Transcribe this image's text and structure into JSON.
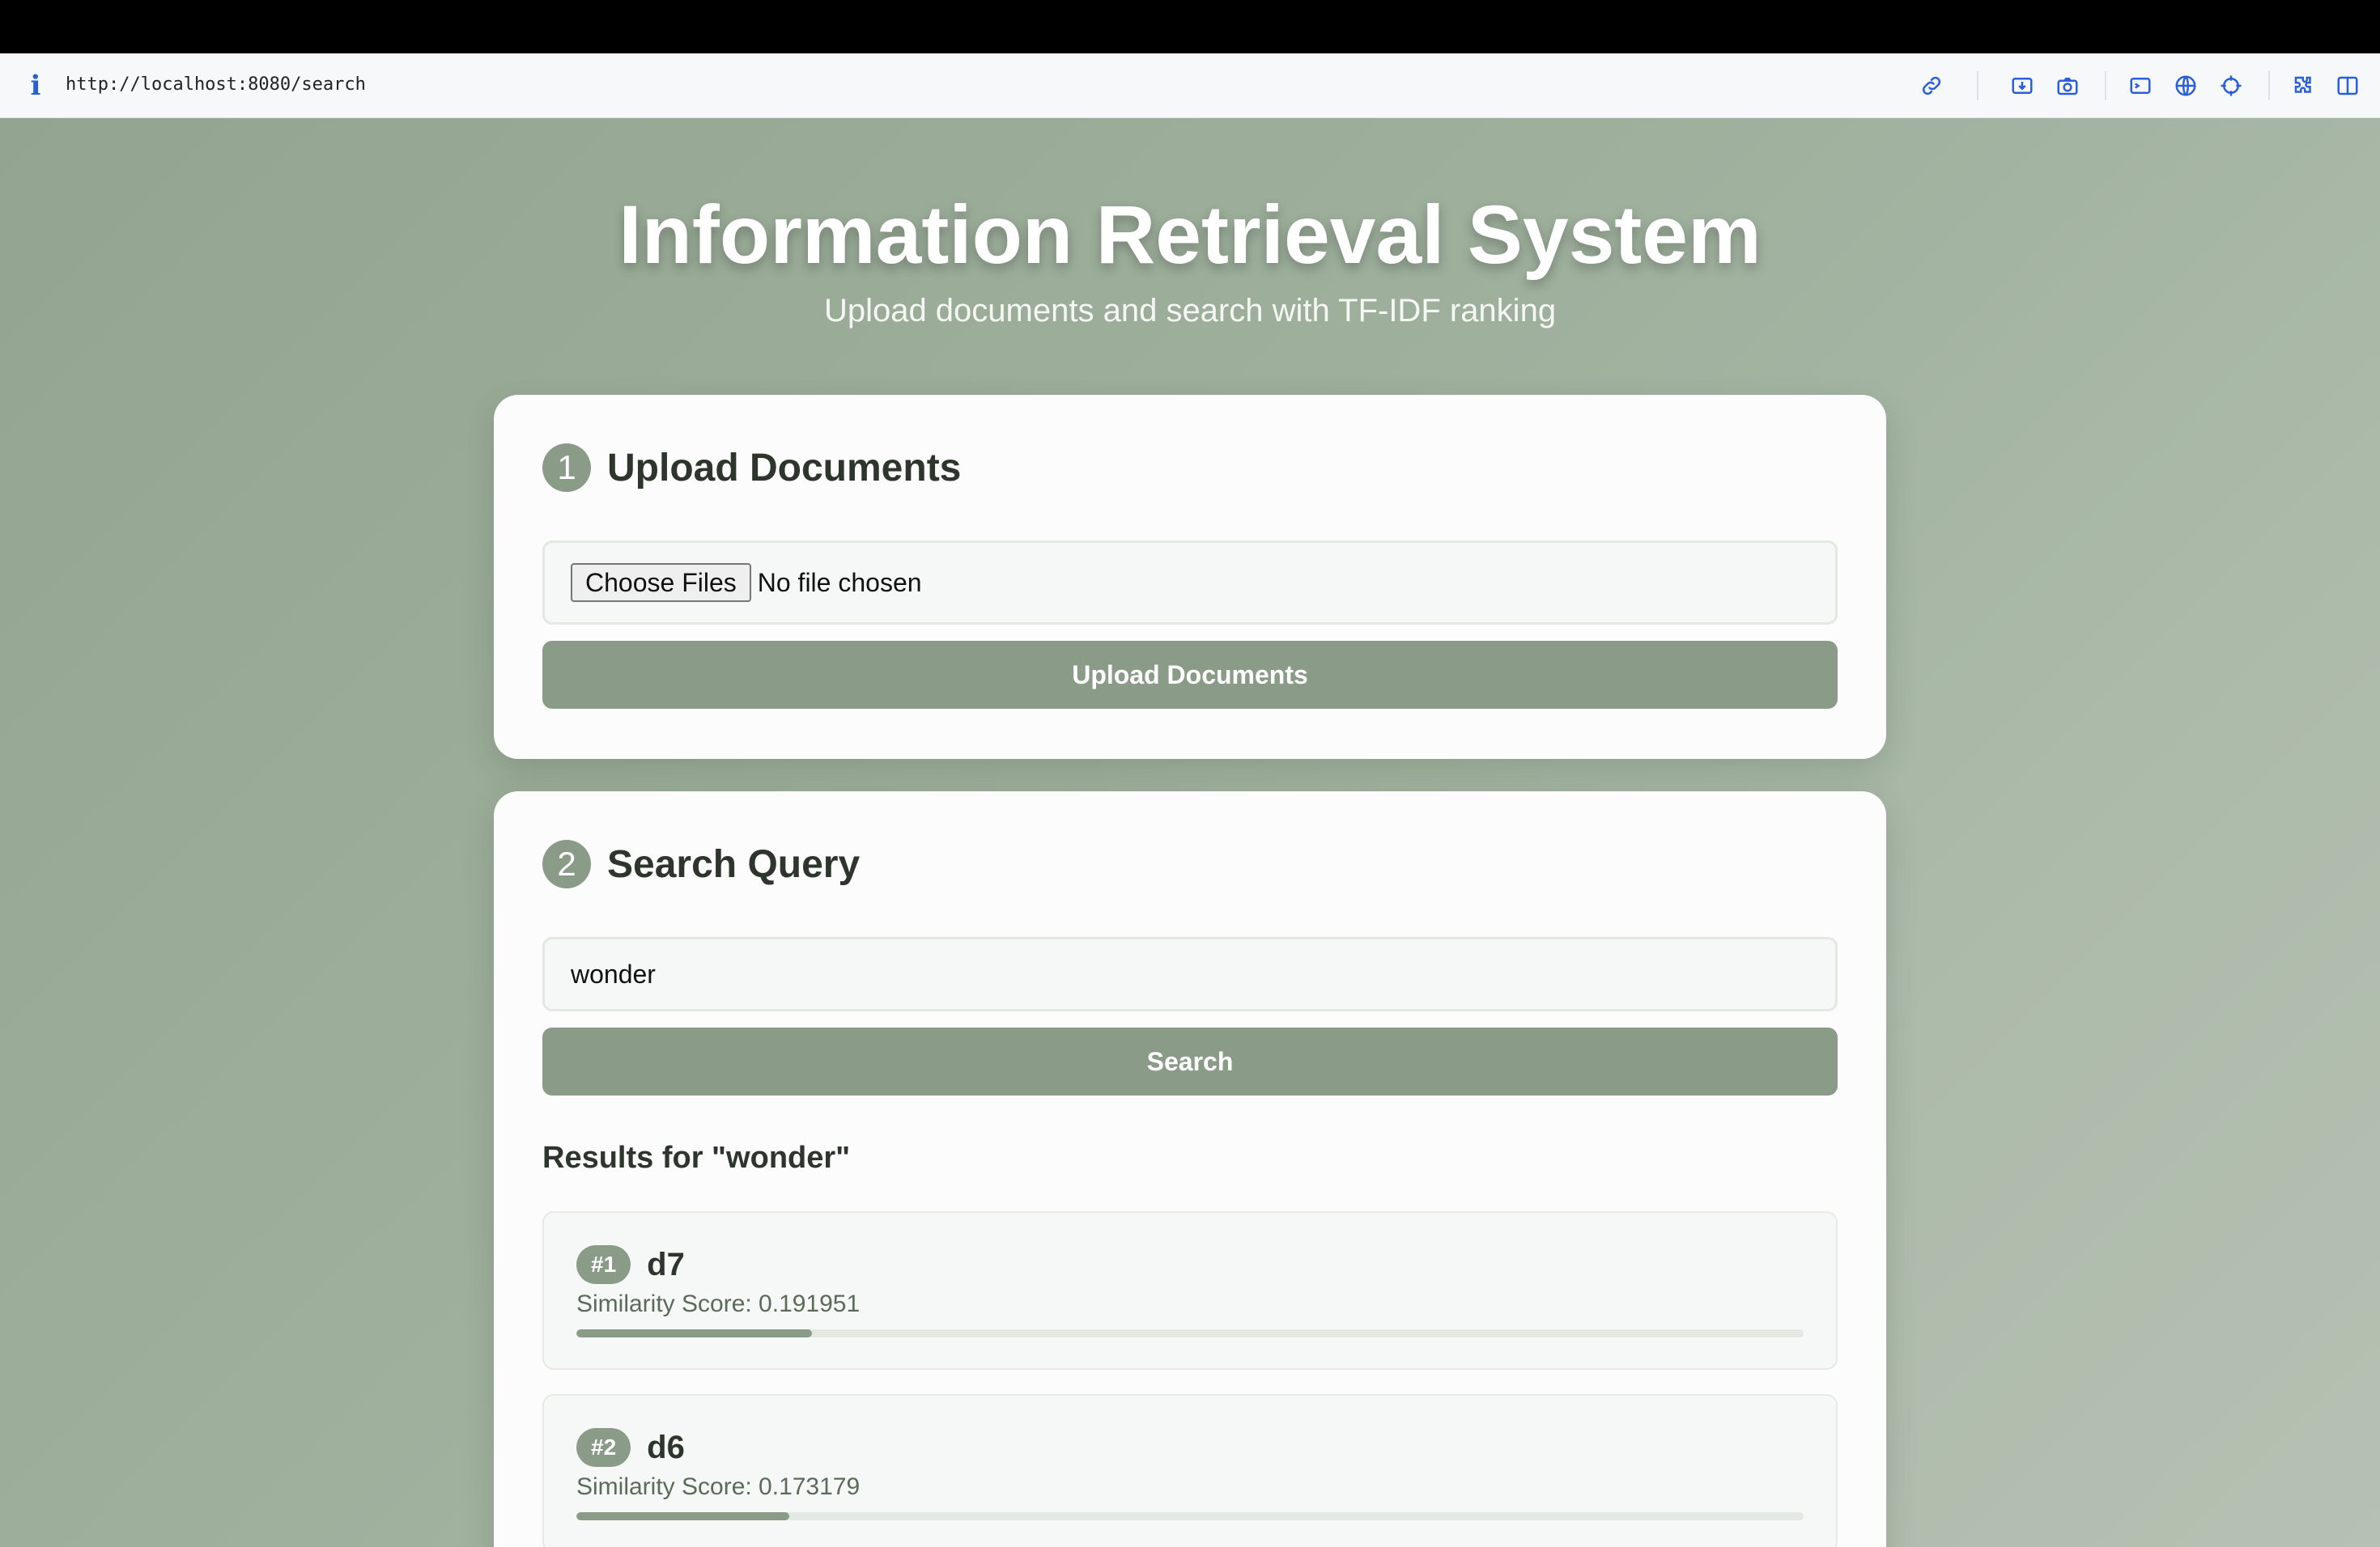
{
  "browser": {
    "url": "http://localhost:8080/search",
    "toolbar_icons": [
      "link-icon",
      "screenshot-icon",
      "camera-icon",
      "terminal-icon",
      "globe-icon",
      "crosshair-icon",
      "extensions-icon",
      "sidebar-icon"
    ]
  },
  "header": {
    "title": "Information Retrieval System",
    "subtitle": "Upload documents and search with TF-IDF ranking"
  },
  "upload": {
    "step_number": "1",
    "title": "Upload Documents",
    "choose_files_label": "Choose Files",
    "file_status": "No file chosen",
    "button_label": "Upload Documents"
  },
  "search": {
    "step_number": "2",
    "title": "Search Query",
    "query_value": "wonder",
    "button_label": "Search",
    "results_heading": "Results for \"wonder\"",
    "results": [
      {
        "rank": "#1",
        "doc": "d7",
        "score_text": "Similarity Score: 0.191951",
        "score": 0.191951
      },
      {
        "rank": "#2",
        "doc": "d6",
        "score_text": "Similarity Score: 0.173179",
        "score": 0.173179
      }
    ]
  },
  "colors": {
    "accent": "#8a9c88",
    "background_start": "#93a591",
    "background_end": "#b5c1b2",
    "browser_icon": "#2b5fd9"
  }
}
